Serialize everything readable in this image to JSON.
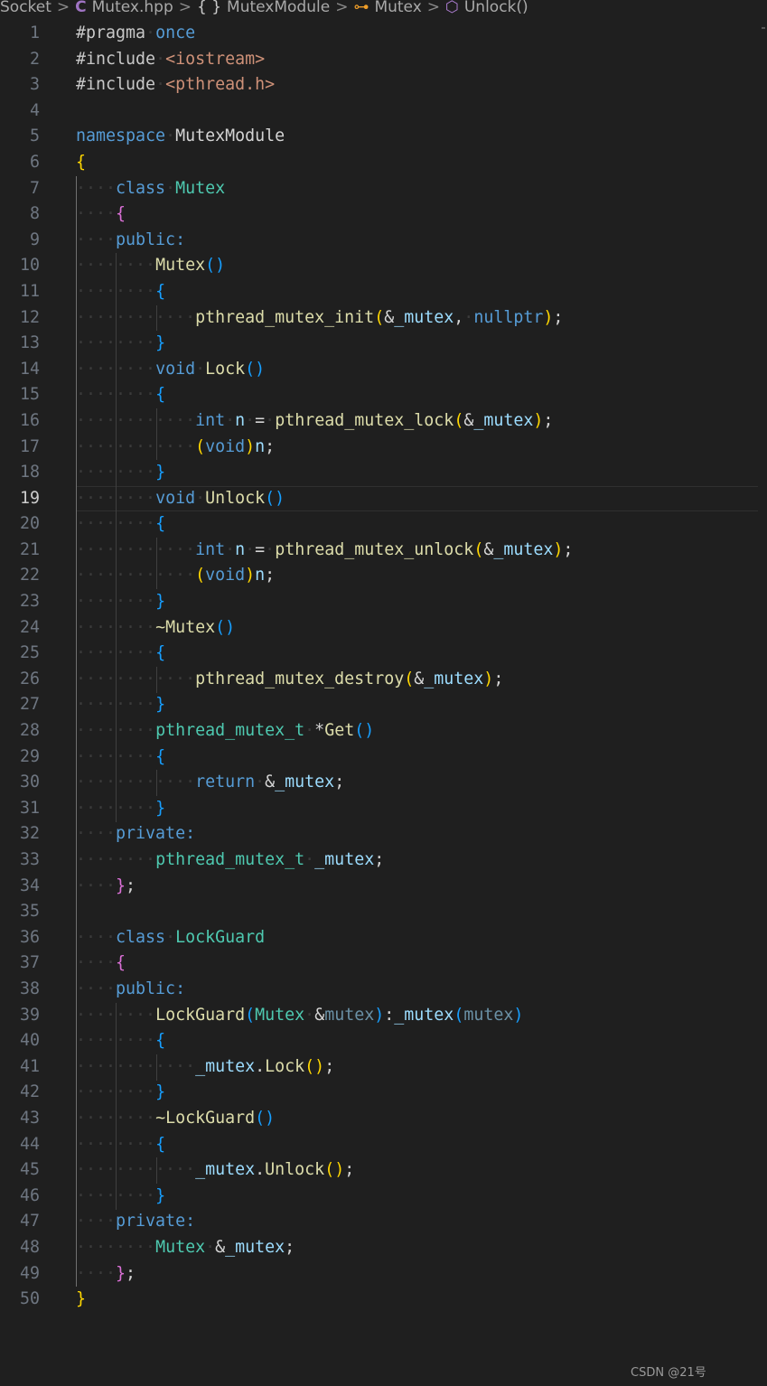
{
  "breadcrumb": {
    "items": [
      {
        "label": "Socket",
        "icon": ""
      },
      {
        "label": "Mutex.hpp",
        "icon": "cpp-file-icon"
      },
      {
        "label": "MutexModule",
        "icon": "namespace-icon"
      },
      {
        "label": "Mutex",
        "icon": "class-icon"
      },
      {
        "label": "Unlock()",
        "icon": "method-icon"
      }
    ],
    "icons": {
      "cpp": "C",
      "namespace": "{ }",
      "class": "⊶",
      "method": "⬡"
    }
  },
  "editor": {
    "active_line": 19,
    "lines": [
      {
        "n": "1",
        "tokens": [
          [
            "t-dir",
            "#pragma"
          ],
          [
            "ws",
            "·"
          ],
          [
            "t-kw",
            "once"
          ]
        ]
      },
      {
        "n": "2",
        "tokens": [
          [
            "t-dir",
            "#include"
          ],
          [
            "ws",
            "·"
          ],
          [
            "t-str",
            "<iostream>"
          ]
        ]
      },
      {
        "n": "3",
        "tokens": [
          [
            "t-dir",
            "#include"
          ],
          [
            "ws",
            "·"
          ],
          [
            "t-str",
            "<pthread.h>"
          ]
        ]
      },
      {
        "n": "4",
        "tokens": []
      },
      {
        "n": "5",
        "tokens": [
          [
            "t-kw",
            "namespace"
          ],
          [
            "ws",
            "·"
          ],
          [
            "t-plain",
            "MutexModule"
          ]
        ]
      },
      {
        "n": "6",
        "tokens": [
          [
            "t-b1",
            "{"
          ]
        ]
      },
      {
        "n": "7",
        "tokens": [
          [
            "ws",
            "····"
          ],
          [
            "t-kw",
            "class"
          ],
          [
            "ws",
            "·"
          ],
          [
            "t-type",
            "Mutex"
          ]
        ]
      },
      {
        "n": "8",
        "tokens": [
          [
            "ws",
            "····"
          ],
          [
            "t-b2",
            "{"
          ]
        ]
      },
      {
        "n": "9",
        "tokens": [
          [
            "ws",
            "····"
          ],
          [
            "t-kw",
            "public:"
          ]
        ]
      },
      {
        "n": "10",
        "tokens": [
          [
            "ws",
            "········"
          ],
          [
            "t-fn",
            "Mutex"
          ],
          [
            "t-b3",
            "()"
          ]
        ]
      },
      {
        "n": "11",
        "tokens": [
          [
            "ws",
            "········"
          ],
          [
            "t-b3",
            "{"
          ]
        ]
      },
      {
        "n": "12",
        "tokens": [
          [
            "ws",
            "············"
          ],
          [
            "t-fn",
            "pthread_mutex_init"
          ],
          [
            "t-b1",
            "("
          ],
          [
            "t-op",
            "&"
          ],
          [
            "t-var",
            "_mutex"
          ],
          [
            "t-op",
            ","
          ],
          [
            "ws",
            "·"
          ],
          [
            "t-kw",
            "nullptr"
          ],
          [
            "t-b1",
            ")"
          ],
          [
            "t-op",
            ";"
          ]
        ]
      },
      {
        "n": "13",
        "tokens": [
          [
            "ws",
            "········"
          ],
          [
            "t-b3",
            "}"
          ]
        ]
      },
      {
        "n": "14",
        "tokens": [
          [
            "ws",
            "········"
          ],
          [
            "t-kw",
            "void"
          ],
          [
            "ws",
            "·"
          ],
          [
            "t-fn",
            "Lock"
          ],
          [
            "t-b3",
            "()"
          ]
        ]
      },
      {
        "n": "15",
        "tokens": [
          [
            "ws",
            "········"
          ],
          [
            "t-b3",
            "{"
          ]
        ]
      },
      {
        "n": "16",
        "tokens": [
          [
            "ws",
            "············"
          ],
          [
            "t-kw",
            "int"
          ],
          [
            "ws",
            "·"
          ],
          [
            "t-var",
            "n"
          ],
          [
            "ws",
            "·"
          ],
          [
            "t-op",
            "="
          ],
          [
            "ws",
            "·"
          ],
          [
            "t-fn",
            "pthread_mutex_lock"
          ],
          [
            "t-b1",
            "("
          ],
          [
            "t-op",
            "&"
          ],
          [
            "t-var",
            "_mutex"
          ],
          [
            "t-b1",
            ")"
          ],
          [
            "t-op",
            ";"
          ]
        ]
      },
      {
        "n": "17",
        "tokens": [
          [
            "ws",
            "············"
          ],
          [
            "t-b1",
            "("
          ],
          [
            "t-kw",
            "void"
          ],
          [
            "t-b1",
            ")"
          ],
          [
            "t-var",
            "n"
          ],
          [
            "t-op",
            ";"
          ]
        ]
      },
      {
        "n": "18",
        "tokens": [
          [
            "ws",
            "········"
          ],
          [
            "t-b3",
            "}"
          ]
        ]
      },
      {
        "n": "19",
        "tokens": [
          [
            "ws",
            "········"
          ],
          [
            "t-kw",
            "void"
          ],
          [
            "ws",
            "·"
          ],
          [
            "t-fn",
            "Unlock"
          ],
          [
            "t-b3",
            "()"
          ]
        ]
      },
      {
        "n": "20",
        "tokens": [
          [
            "ws",
            "········"
          ],
          [
            "t-b3",
            "{"
          ]
        ]
      },
      {
        "n": "21",
        "tokens": [
          [
            "ws",
            "············"
          ],
          [
            "t-kw",
            "int"
          ],
          [
            "ws",
            "·"
          ],
          [
            "t-var",
            "n"
          ],
          [
            "ws",
            "·"
          ],
          [
            "t-op",
            "="
          ],
          [
            "ws",
            "·"
          ],
          [
            "t-fn",
            "pthread_mutex_unlock"
          ],
          [
            "t-b1",
            "("
          ],
          [
            "t-op",
            "&"
          ],
          [
            "t-var",
            "_mutex"
          ],
          [
            "t-b1",
            ")"
          ],
          [
            "t-op",
            ";"
          ]
        ]
      },
      {
        "n": "22",
        "tokens": [
          [
            "ws",
            "············"
          ],
          [
            "t-b1",
            "("
          ],
          [
            "t-kw",
            "void"
          ],
          [
            "t-b1",
            ")"
          ],
          [
            "t-var",
            "n"
          ],
          [
            "t-op",
            ";"
          ]
        ]
      },
      {
        "n": "23",
        "tokens": [
          [
            "ws",
            "········"
          ],
          [
            "t-b3",
            "}"
          ]
        ]
      },
      {
        "n": "24",
        "tokens": [
          [
            "ws",
            "········"
          ],
          [
            "t-fn",
            "~Mutex"
          ],
          [
            "t-b3",
            "()"
          ]
        ]
      },
      {
        "n": "25",
        "tokens": [
          [
            "ws",
            "········"
          ],
          [
            "t-b3",
            "{"
          ]
        ]
      },
      {
        "n": "26",
        "tokens": [
          [
            "ws",
            "············"
          ],
          [
            "t-fn",
            "pthread_mutex_destroy"
          ],
          [
            "t-b1",
            "("
          ],
          [
            "t-op",
            "&"
          ],
          [
            "t-var",
            "_mutex"
          ],
          [
            "t-b1",
            ")"
          ],
          [
            "t-op",
            ";"
          ]
        ]
      },
      {
        "n": "27",
        "tokens": [
          [
            "ws",
            "········"
          ],
          [
            "t-b3",
            "}"
          ]
        ]
      },
      {
        "n": "28",
        "tokens": [
          [
            "ws",
            "········"
          ],
          [
            "t-type",
            "pthread_mutex_t"
          ],
          [
            "ws",
            "·"
          ],
          [
            "t-op",
            "*"
          ],
          [
            "t-fn",
            "Get"
          ],
          [
            "t-b3",
            "()"
          ]
        ]
      },
      {
        "n": "29",
        "tokens": [
          [
            "ws",
            "········"
          ],
          [
            "t-b3",
            "{"
          ]
        ]
      },
      {
        "n": "30",
        "tokens": [
          [
            "ws",
            "············"
          ],
          [
            "t-kw",
            "return"
          ],
          [
            "ws",
            "·"
          ],
          [
            "t-op",
            "&"
          ],
          [
            "t-var",
            "_mutex"
          ],
          [
            "t-op",
            ";"
          ]
        ]
      },
      {
        "n": "31",
        "tokens": [
          [
            "ws",
            "········"
          ],
          [
            "t-b3",
            "}"
          ]
        ]
      },
      {
        "n": "32",
        "tokens": [
          [
            "ws",
            "····"
          ],
          [
            "t-kw",
            "private:"
          ]
        ]
      },
      {
        "n": "33",
        "tokens": [
          [
            "ws",
            "········"
          ],
          [
            "t-type",
            "pthread_mutex_t"
          ],
          [
            "ws",
            "·"
          ],
          [
            "t-var",
            "_mutex"
          ],
          [
            "t-op",
            ";"
          ]
        ]
      },
      {
        "n": "34",
        "tokens": [
          [
            "ws",
            "····"
          ],
          [
            "t-b2",
            "}"
          ],
          [
            "t-op",
            ";"
          ]
        ]
      },
      {
        "n": "35",
        "tokens": []
      },
      {
        "n": "36",
        "tokens": [
          [
            "ws",
            "····"
          ],
          [
            "t-kw",
            "class"
          ],
          [
            "ws",
            "·"
          ],
          [
            "t-type",
            "LockGuard"
          ]
        ]
      },
      {
        "n": "37",
        "tokens": [
          [
            "ws",
            "····"
          ],
          [
            "t-b2",
            "{"
          ]
        ]
      },
      {
        "n": "38",
        "tokens": [
          [
            "ws",
            "····"
          ],
          [
            "t-kw",
            "public:"
          ]
        ]
      },
      {
        "n": "39",
        "tokens": [
          [
            "ws",
            "········"
          ],
          [
            "t-fn",
            "LockGuard"
          ],
          [
            "t-b3",
            "("
          ],
          [
            "t-type",
            "Mutex"
          ],
          [
            "ws",
            "·"
          ],
          [
            "t-op",
            "&"
          ],
          [
            "t-param",
            "mutex"
          ],
          [
            "t-b3",
            ")"
          ],
          [
            "t-op",
            ":"
          ],
          [
            "t-var",
            "_mutex"
          ],
          [
            "t-b3",
            "("
          ],
          [
            "t-param",
            "mutex"
          ],
          [
            "t-b3",
            ")"
          ]
        ]
      },
      {
        "n": "40",
        "tokens": [
          [
            "ws",
            "········"
          ],
          [
            "t-b3",
            "{"
          ]
        ]
      },
      {
        "n": "41",
        "tokens": [
          [
            "ws",
            "············"
          ],
          [
            "t-var",
            "_mutex"
          ],
          [
            "t-op",
            "."
          ],
          [
            "t-fn",
            "Lock"
          ],
          [
            "t-b1",
            "()"
          ],
          [
            "t-op",
            ";"
          ]
        ]
      },
      {
        "n": "42",
        "tokens": [
          [
            "ws",
            "········"
          ],
          [
            "t-b3",
            "}"
          ]
        ]
      },
      {
        "n": "43",
        "tokens": [
          [
            "ws",
            "········"
          ],
          [
            "t-fn",
            "~LockGuard"
          ],
          [
            "t-b3",
            "()"
          ]
        ]
      },
      {
        "n": "44",
        "tokens": [
          [
            "ws",
            "········"
          ],
          [
            "t-b3",
            "{"
          ]
        ]
      },
      {
        "n": "45",
        "tokens": [
          [
            "ws",
            "············"
          ],
          [
            "t-var",
            "_mutex"
          ],
          [
            "t-op",
            "."
          ],
          [
            "t-fn",
            "Unlock"
          ],
          [
            "t-b1",
            "()"
          ],
          [
            "t-op",
            ";"
          ]
        ]
      },
      {
        "n": "46",
        "tokens": [
          [
            "ws",
            "········"
          ],
          [
            "t-b3",
            "}"
          ]
        ]
      },
      {
        "n": "47",
        "tokens": [
          [
            "ws",
            "····"
          ],
          [
            "t-kw",
            "private:"
          ]
        ]
      },
      {
        "n": "48",
        "tokens": [
          [
            "ws",
            "········"
          ],
          [
            "t-type",
            "Mutex"
          ],
          [
            "ws",
            "·"
          ],
          [
            "t-op",
            "&"
          ],
          [
            "t-var",
            "_mutex"
          ],
          [
            "t-op",
            ";"
          ]
        ]
      },
      {
        "n": "49",
        "tokens": [
          [
            "ws",
            "····"
          ],
          [
            "t-b2",
            "}"
          ],
          [
            "t-op",
            ";"
          ]
        ]
      },
      {
        "n": "50",
        "tokens": [
          [
            "t-b1",
            "}"
          ]
        ]
      }
    ]
  },
  "watermark": {
    "text": "CSDN @21号"
  },
  "colors": {
    "background": "#1f1f1f",
    "keyword": "#569cd6",
    "type": "#4ec9b0",
    "function": "#dcdcaa",
    "string": "#ce9178",
    "variable": "#9cdcfe"
  }
}
